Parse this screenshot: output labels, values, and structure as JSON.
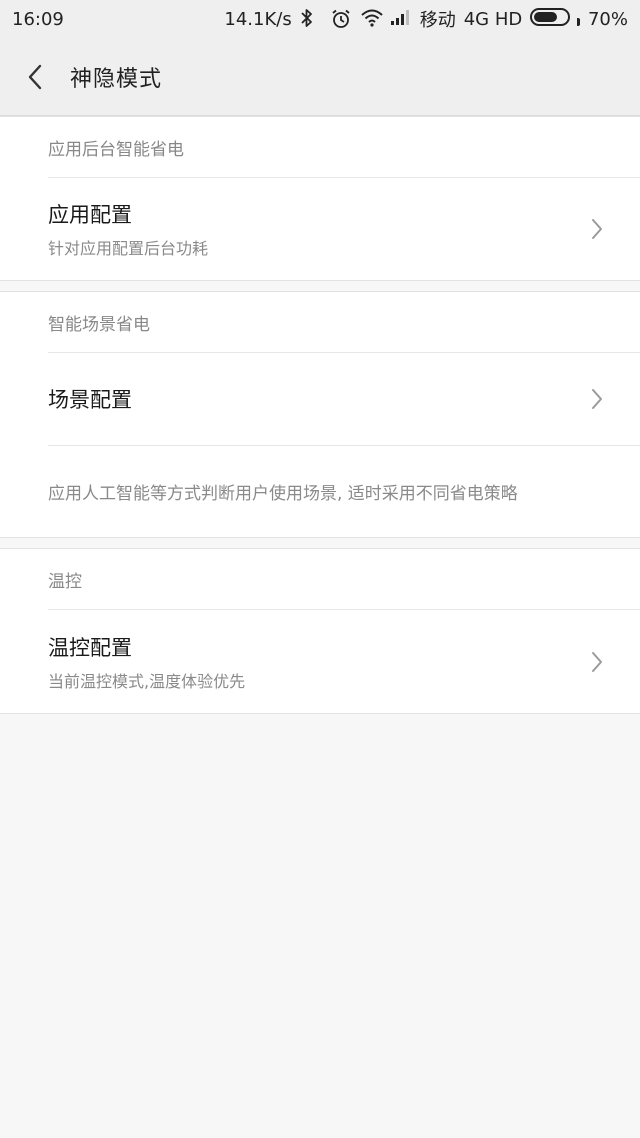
{
  "status_bar": {
    "time": "16:09",
    "net_speed": "14.1K/s",
    "carrier": "移动",
    "network": "4G HD",
    "battery": "70%",
    "battery_level": 0.7,
    "icons": [
      "bluetooth-icon",
      "alarm-icon",
      "wifi-icon",
      "signal-icon",
      "battery-icon"
    ]
  },
  "header": {
    "back_icon": "chevron-left-icon",
    "title": "神隐模式"
  },
  "sections": [
    {
      "header": "应用后台智能省电",
      "items": [
        {
          "title": "应用配置",
          "subtitle": "针对应用配置后台功耗"
        }
      ]
    },
    {
      "header": "智能场景省电",
      "items": [
        {
          "title": "场景配置",
          "subtitle": ""
        }
      ],
      "note": "应用人工智能等方式判断用户使用场景, 适时采用不同省电策略"
    },
    {
      "header": "温控",
      "items": [
        {
          "title": "温控配置",
          "subtitle": "当前温控模式,温度体验优先"
        }
      ]
    }
  ]
}
